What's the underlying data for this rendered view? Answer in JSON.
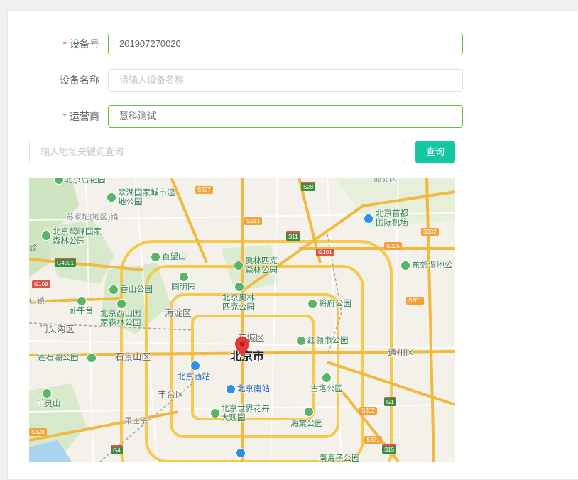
{
  "form": {
    "device_no": {
      "label": "设备号",
      "value": "201907270020",
      "required_mark": "*"
    },
    "device_name": {
      "label": "设备名称",
      "placeholder": "请输入设备名称"
    },
    "operator": {
      "label": "运营商",
      "value": "慧科测试",
      "required_mark": "*"
    }
  },
  "search": {
    "placeholder": "输入地址关键词查询",
    "button_label": "查询"
  },
  "colors": {
    "accent": "#13c8a0",
    "valid_border": "#67c23a",
    "required": "#f56c6c",
    "park": "#59b467",
    "marker": "#e53935"
  },
  "map": {
    "city_label": "北京市",
    "districts": [
      "海淀区",
      "东城区",
      "通州区",
      "石景山区",
      "丰台区",
      "门头沟区"
    ],
    "town_label": "苏家坨(地区)镇",
    "places": [
      {
        "name": "北京后花园",
        "icon": "park-icon"
      },
      {
        "name": "翠湖国家城市湿地公园",
        "icon": "park-icon"
      },
      {
        "name": "北京鹫峰国家森林公园",
        "icon": "park-icon"
      },
      {
        "name": "百望山",
        "icon": "park-icon"
      },
      {
        "name": "奥林匹克森林公园",
        "icon": "park-icon"
      },
      {
        "name": "香山公园",
        "icon": "park-icon"
      },
      {
        "name": "圆明园",
        "icon": "park-icon"
      },
      {
        "name": "卧牛台",
        "icon": "park-icon"
      },
      {
        "name": "北京西山国家森林公园",
        "icon": "park-icon"
      },
      {
        "name": "北京奥林匹克公园",
        "icon": "park-icon"
      },
      {
        "name": "将府公园",
        "icon": "park-icon"
      },
      {
        "name": "东郊湿地公",
        "icon": "park-icon"
      },
      {
        "name": "北京首都国际机场",
        "icon": "airport-icon"
      },
      {
        "name": "红领巾公园",
        "icon": "park-icon"
      },
      {
        "name": "莲石湖公园",
        "icon": "park-icon"
      },
      {
        "name": "北京西站",
        "icon": "station-icon"
      },
      {
        "name": "北京南站",
        "icon": "station-icon"
      },
      {
        "name": "古塔公园",
        "icon": "park-icon"
      },
      {
        "name": "千灵山",
        "icon": "park-icon"
      },
      {
        "name": "北京世界花卉大观园",
        "icon": "park-icon"
      },
      {
        "name": "海棠公园",
        "icon": "park-icon"
      }
    ],
    "partial_labels": [
      "顺义区",
      "岭",
      "山镇",
      "果庄子",
      "南海子公园"
    ],
    "roads": [
      "S327",
      "S28",
      "S213",
      "S11",
      "G101",
      "S225",
      "S332",
      "G4501",
      "G109",
      "S201",
      "G1",
      "S302",
      "S331",
      "S15",
      "G4",
      "S328"
    ]
  }
}
